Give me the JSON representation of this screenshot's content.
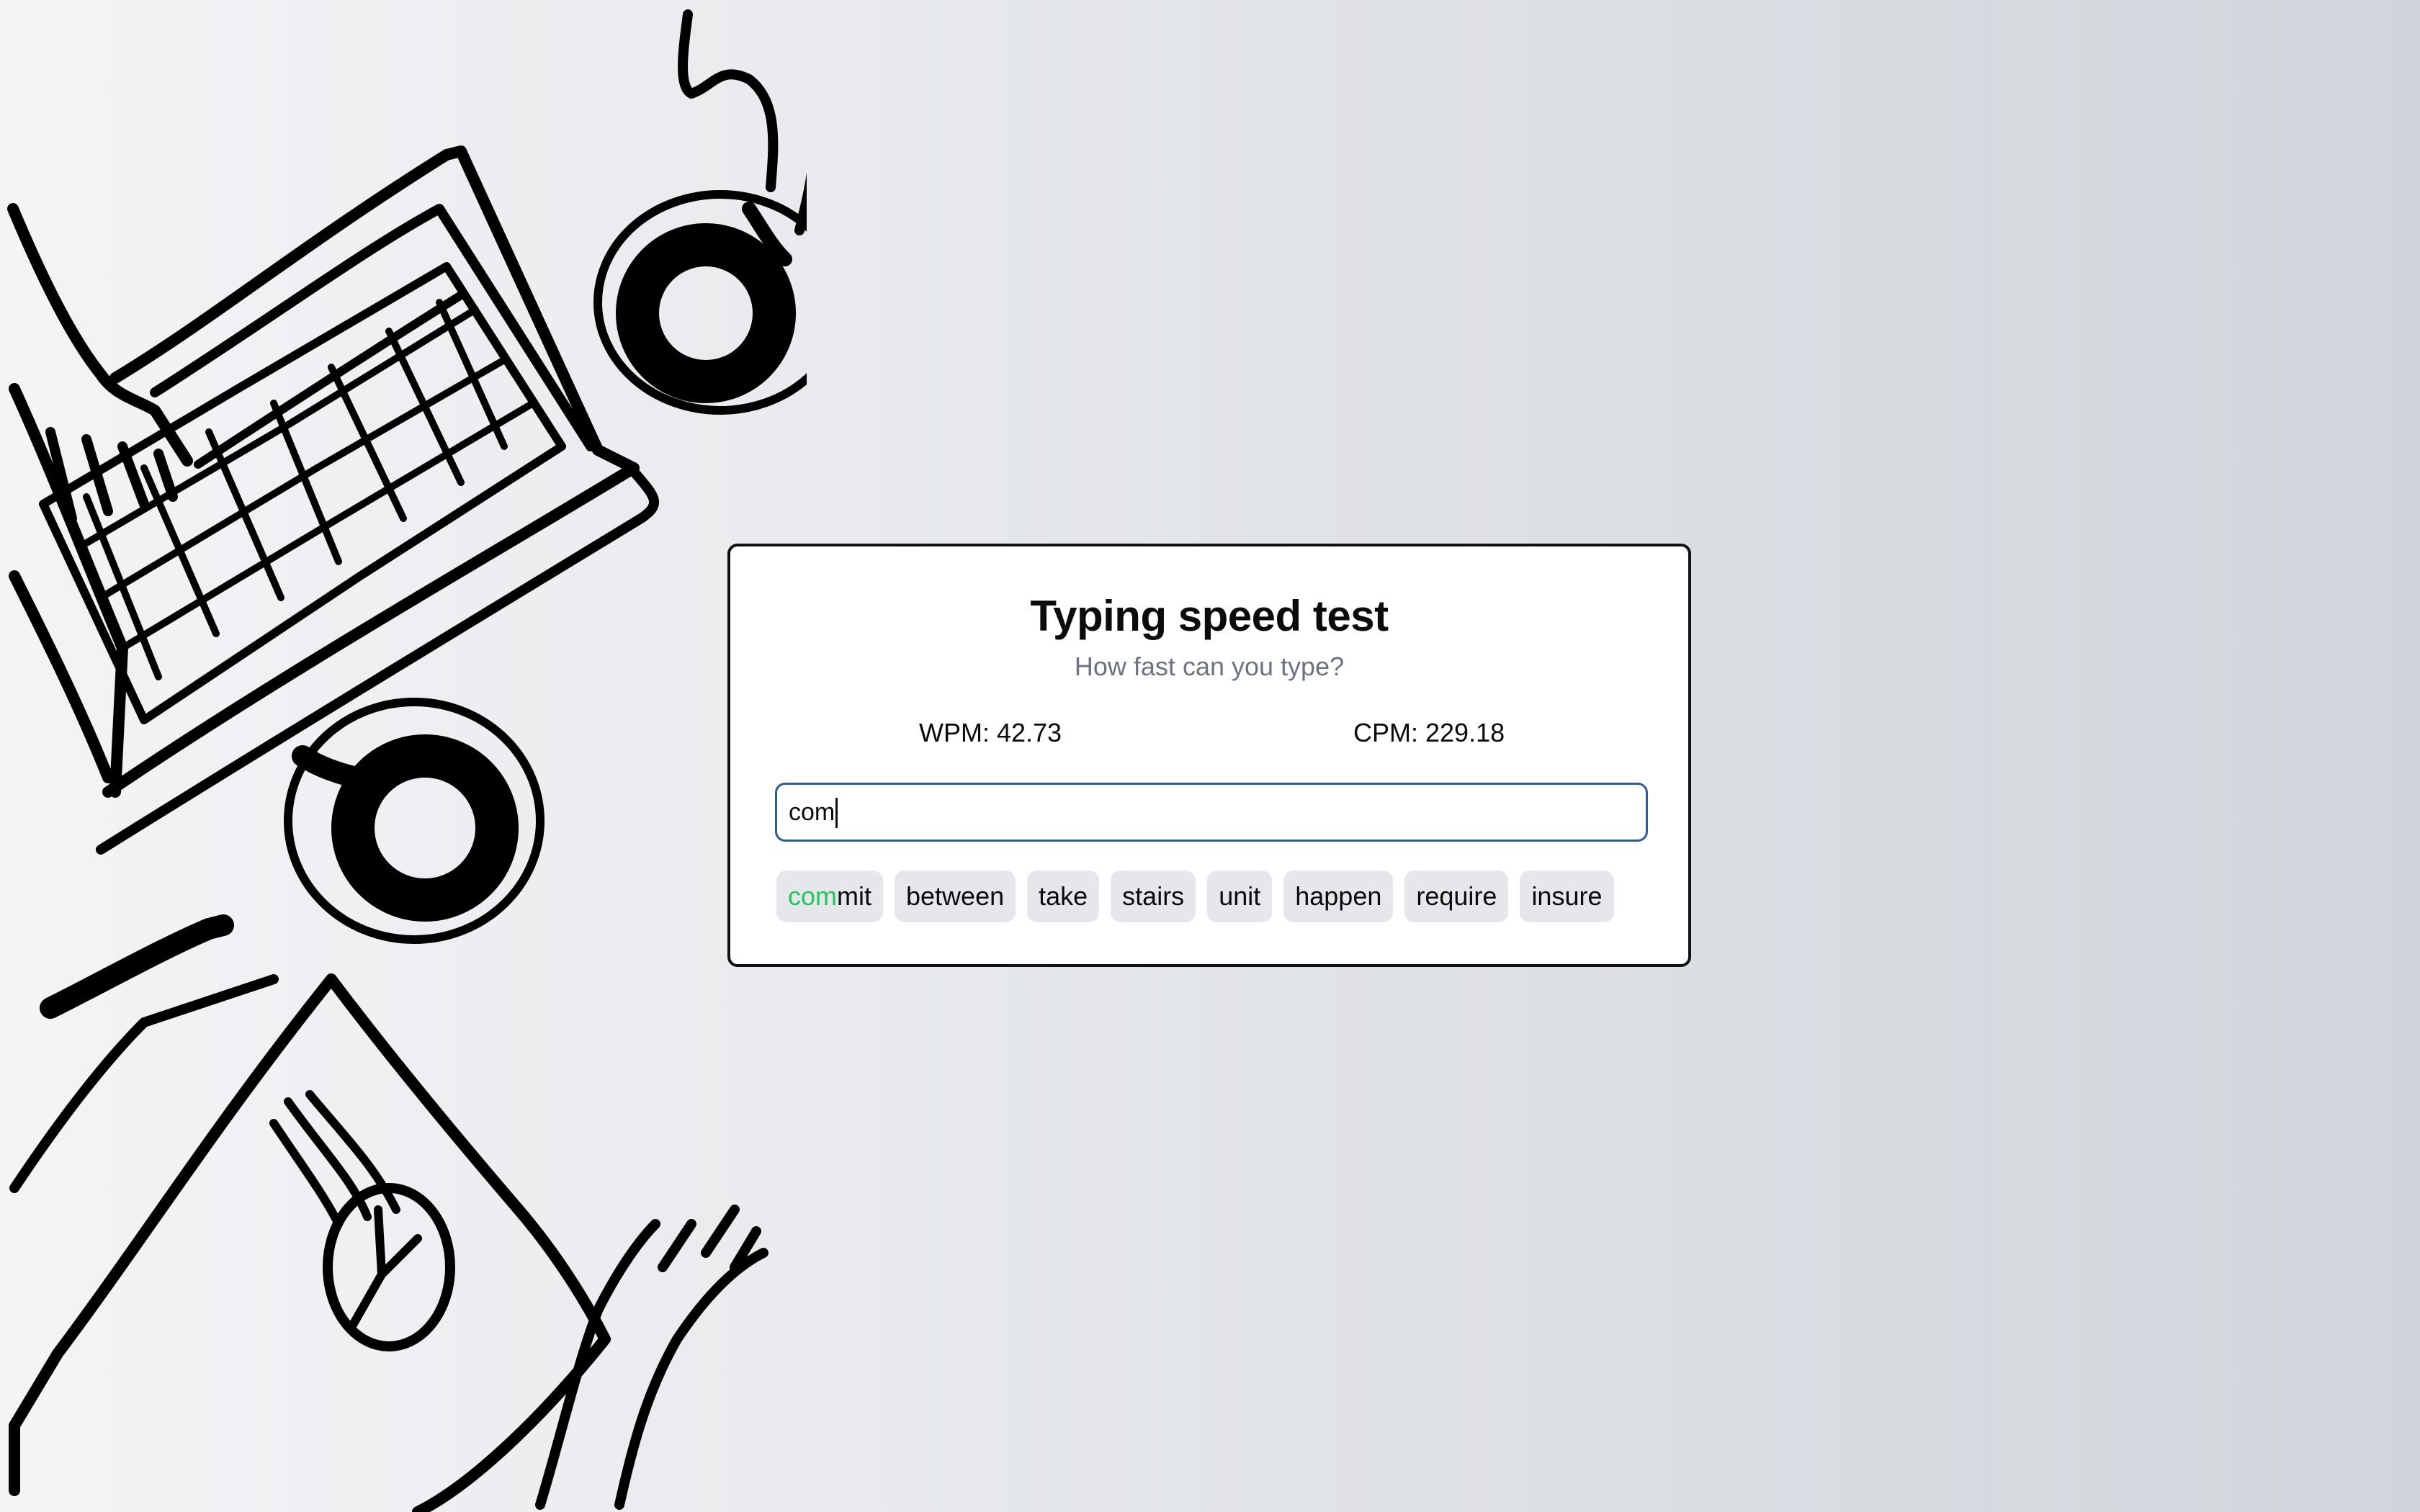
{
  "app": {
    "title": "Typing speed test",
    "subtitle": "How fast can you type?"
  },
  "stats": {
    "wpm_label": "WPM: 42.73",
    "cpm_label": "CPM: 229.18",
    "wpm": 42.73,
    "cpm": 229.18
  },
  "input": {
    "value": "com",
    "placeholder": ""
  },
  "words": {
    "current": {
      "typed": "com",
      "rest": "mit",
      "full": "commit"
    },
    "upcoming": [
      "between",
      "take",
      "stairs",
      "unit",
      "happen",
      "require",
      "insure"
    ]
  },
  "colors": {
    "correct": "#22c55e",
    "input_border": "#2d5c96",
    "chip_bg": "#e5e7eb",
    "subtitle": "#6b7280"
  },
  "illustration": {
    "description": "Hand-drawn line art: laptop keyboard with hands, two coffee cups, pen, document with pie chart, hand"
  }
}
